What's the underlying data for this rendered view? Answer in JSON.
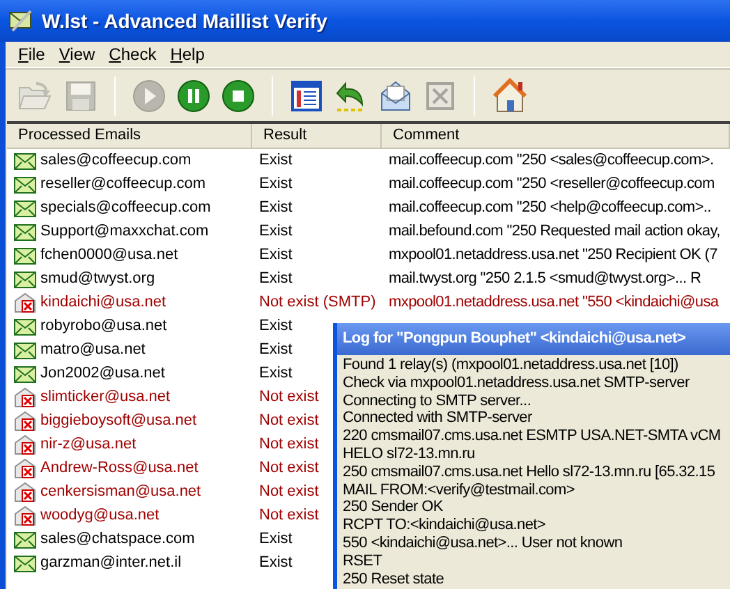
{
  "window": {
    "title": "W.lst - Advanced Maillist Verify"
  },
  "menu": [
    "File",
    "View",
    "Check",
    "Help"
  ],
  "toolbar": [
    {
      "kind": "open",
      "disabled": true
    },
    {
      "kind": "save",
      "disabled": true
    },
    {
      "kind": "separator"
    },
    {
      "kind": "play",
      "disabled": true
    },
    {
      "kind": "pause",
      "disabled": false
    },
    {
      "kind": "stop",
      "disabled": false
    },
    {
      "kind": "separator"
    },
    {
      "kind": "list",
      "disabled": false
    },
    {
      "kind": "undo",
      "disabled": false
    },
    {
      "kind": "mail",
      "disabled": false
    },
    {
      "kind": "excel",
      "disabled": true
    },
    {
      "kind": "separator"
    },
    {
      "kind": "home",
      "disabled": false
    }
  ],
  "table": {
    "columns": [
      "Processed Emails",
      "Result",
      "Comment"
    ],
    "rows": [
      {
        "kind": "exist",
        "email": "sales@coffeecup.com",
        "result": "Exist",
        "comment": "mail.coffeecup.com \"250 <sales@coffeecup.com>."
      },
      {
        "kind": "exist",
        "email": "reseller@coffeecup.com",
        "result": "Exist",
        "comment": "mail.coffeecup.com \"250 <reseller@coffeecup.com"
      },
      {
        "kind": "exist",
        "email": "specials@coffeecup.com",
        "result": "Exist",
        "comment": "mail.coffeecup.com \"250 <help@coffeecup.com>.."
      },
      {
        "kind": "exist",
        "email": "Support@maxxchat.com",
        "result": "Exist",
        "comment": "mail.befound.com \"250 Requested mail action okay,"
      },
      {
        "kind": "exist",
        "email": "fchen0000@usa.net",
        "result": "Exist",
        "comment": "mxpool01.netaddress.usa.net \"250 Recipient OK (7"
      },
      {
        "kind": "exist",
        "email": "smud@twyst.org",
        "result": "Exist",
        "comment": "mail.twyst.org \"250 2.1.5 <smud@twyst.org>... R"
      },
      {
        "kind": "not_exist",
        "email": "kindaichi@usa.net",
        "result": "Not exist (SMTP)",
        "comment": "mxpool01.netaddress.usa.net \"550 <kindaichi@usa"
      },
      {
        "kind": "exist",
        "email": "robyrobo@usa.net",
        "result": "Exist"
      },
      {
        "kind": "exist",
        "email": "matro@usa.net",
        "result": "Exist"
      },
      {
        "kind": "exist",
        "email": "Jon2002@usa.net",
        "result": "Exist"
      },
      {
        "kind": "not_exist",
        "email": "slimticker@usa.net",
        "result": "Not exist"
      },
      {
        "kind": "not_exist",
        "email": "biggieboysoft@usa.net",
        "result": "Not exist"
      },
      {
        "kind": "not_exist",
        "email": "nir-z@usa.net",
        "result": "Not exist"
      },
      {
        "kind": "not_exist",
        "email": "Andrew-Ross@usa.net",
        "result": "Not exist"
      },
      {
        "kind": "not_exist",
        "email": "cenkersisman@usa.net",
        "result": "Not exist"
      },
      {
        "kind": "not_exist",
        "email": "woodyg@usa.net",
        "result": "Not exist"
      },
      {
        "kind": "exist",
        "email": "sales@chatspace.com",
        "result": "Exist"
      },
      {
        "kind": "exist",
        "email": "garzman@inter.net.il",
        "result": "Exist"
      }
    ]
  },
  "log_window": {
    "title": "Log for \"Pongpun Bouphet\" <kindaichi@usa.net>",
    "lines": [
      "Found 1 relay(s) (mxpool01.netaddress.usa.net [10])",
      "Check via mxpool01.netaddress.usa.net SMTP-server",
      "Connecting to SMTP server...",
      "Connected with SMTP-server",
      "220 cmsmail07.cms.usa.net ESMTP USA.NET-SMTA vCM",
      "HELO sl72-13.mn.ru",
      "250 cmsmail07.cms.usa.net Hello sl72-13.mn.ru [65.32.15",
      "MAIL FROM:<verify@testmail.com>",
      "250 Sender OK",
      "RCPT TO:<kindaichi@usa.net>",
      "550 <kindaichi@usa.net>... User not known",
      "RSET",
      "250 Reset state"
    ]
  }
}
